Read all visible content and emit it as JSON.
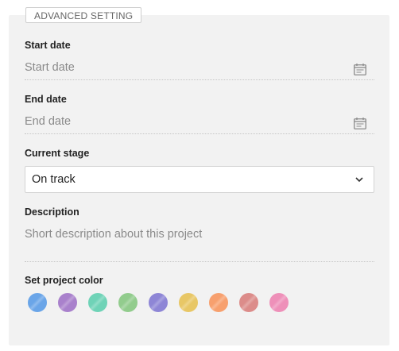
{
  "section": {
    "tab_label": "ADVANCED SETTING"
  },
  "start_date": {
    "label": "Start date",
    "placeholder": "Start date",
    "icon": "calendar-icon"
  },
  "end_date": {
    "label": "End date",
    "placeholder": "End date",
    "icon": "calendar-icon"
  },
  "stage": {
    "label": "Current stage",
    "selected": "On track",
    "icon": "chevron-down-icon"
  },
  "description": {
    "label": "Description",
    "placeholder": "Short description about this project"
  },
  "project_color": {
    "label": "Set project color",
    "colors": [
      "#6aa5e8",
      "#a981cc",
      "#6fd3b7",
      "#92cc8d",
      "#8e86d6",
      "#e8c766",
      "#f7a06e",
      "#dc8c8a",
      "#ee90b9"
    ]
  }
}
